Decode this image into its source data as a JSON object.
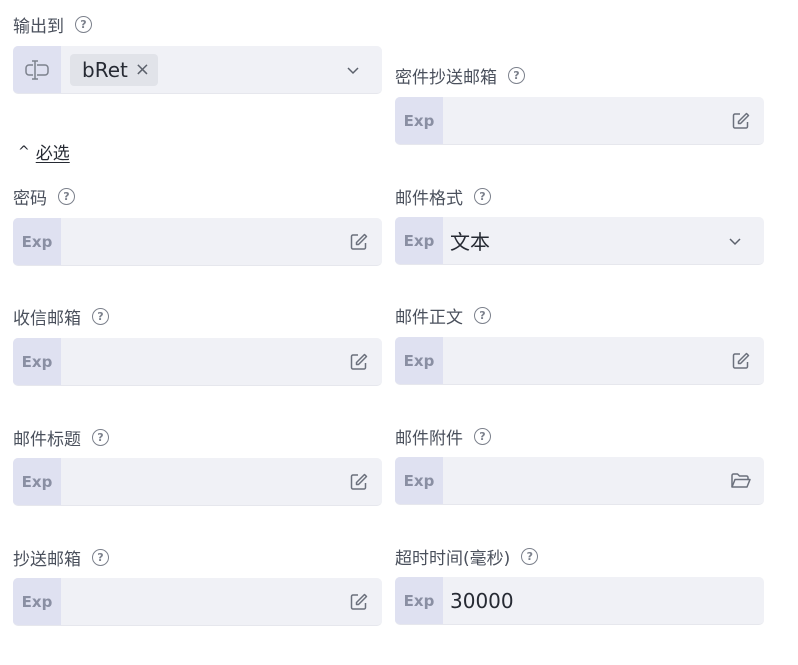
{
  "output": {
    "label": "输出到",
    "tag_value": "bRet",
    "tag_remove_icon": "close-icon",
    "variable_icon": "variable-cursor-icon",
    "dropdown_icon": "chevron-down-icon"
  },
  "required_toggle": {
    "caret": "^",
    "label": "必选"
  },
  "exp_label": "Exp",
  "help_glyph": "?",
  "fields": {
    "bcc": {
      "label": "密件抄送邮箱",
      "value": "",
      "icon": "edit-icon"
    },
    "password": {
      "label": "密码",
      "value": "",
      "icon": "edit-icon"
    },
    "mail_format": {
      "label": "邮件格式",
      "value": "文本",
      "icon": "chevron-down-icon"
    },
    "recipient": {
      "label": "收信邮箱",
      "value": "",
      "icon": "edit-icon"
    },
    "body": {
      "label": "邮件正文",
      "value": "",
      "icon": "edit-icon"
    },
    "subject": {
      "label": "邮件标题",
      "value": "",
      "icon": "edit-icon"
    },
    "attachment": {
      "label": "邮件附件",
      "value": "",
      "icon": "folder-open-icon"
    },
    "cc": {
      "label": "抄送邮箱",
      "value": "",
      "icon": "edit-icon"
    },
    "timeout": {
      "label": "超时时间(毫秒)",
      "value": "30000"
    }
  },
  "colors": {
    "field_bg": "#f0f1f6",
    "exp_bg": "#dfe1f1",
    "exp_text": "#8a8fa3",
    "label_text": "#4a505c"
  }
}
